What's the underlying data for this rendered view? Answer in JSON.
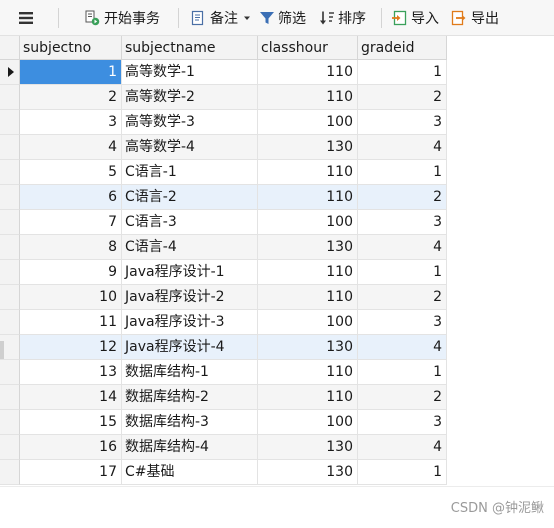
{
  "toolbar": {
    "menu_icon": "hamburger-icon",
    "begin_transaction": "开始事务",
    "notes": "备注",
    "filter": "筛选",
    "sort": "排序",
    "import": "导入",
    "export": "导出"
  },
  "table": {
    "columns": [
      "subjectno",
      "subjectname",
      "classhour",
      "gradeid"
    ],
    "rows": [
      {
        "subjectno": "1",
        "subjectname": "高等数学-1",
        "classhour": "110",
        "gradeid": "1"
      },
      {
        "subjectno": "2",
        "subjectname": "高等数学-2",
        "classhour": "110",
        "gradeid": "2"
      },
      {
        "subjectno": "3",
        "subjectname": "高等数学-3",
        "classhour": "100",
        "gradeid": "3"
      },
      {
        "subjectno": "4",
        "subjectname": "高等数学-4",
        "classhour": "130",
        "gradeid": "4"
      },
      {
        "subjectno": "5",
        "subjectname": "C语言-1",
        "classhour": "110",
        "gradeid": "1"
      },
      {
        "subjectno": "6",
        "subjectname": "C语言-2",
        "classhour": "110",
        "gradeid": "2"
      },
      {
        "subjectno": "7",
        "subjectname": "C语言-3",
        "classhour": "100",
        "gradeid": "3"
      },
      {
        "subjectno": "8",
        "subjectname": "C语言-4",
        "classhour": "130",
        "gradeid": "4"
      },
      {
        "subjectno": "9",
        "subjectname": "Java程序设计-1",
        "classhour": "110",
        "gradeid": "1"
      },
      {
        "subjectno": "10",
        "subjectname": "Java程序设计-2",
        "classhour": "110",
        "gradeid": "2"
      },
      {
        "subjectno": "11",
        "subjectname": "Java程序设计-3",
        "classhour": "100",
        "gradeid": "3"
      },
      {
        "subjectno": "12",
        "subjectname": "Java程序设计-4",
        "classhour": "130",
        "gradeid": "4"
      },
      {
        "subjectno": "13",
        "subjectname": "数据库结构-1",
        "classhour": "110",
        "gradeid": "1"
      },
      {
        "subjectno": "14",
        "subjectname": "数据库结构-2",
        "classhour": "110",
        "gradeid": "2"
      },
      {
        "subjectno": "15",
        "subjectname": "数据库结构-3",
        "classhour": "100",
        "gradeid": "3"
      },
      {
        "subjectno": "16",
        "subjectname": "数据库结构-4",
        "classhour": "130",
        "gradeid": "4"
      },
      {
        "subjectno": "17",
        "subjectname": "C#基础",
        "classhour": "130",
        "gradeid": "1"
      }
    ],
    "selected_row_index": 0,
    "highlighted_rows": [
      5,
      11
    ]
  },
  "watermark": "CSDN @钟泥鳅",
  "colors": {
    "active_cell": "#3d8ee0",
    "selected_row": "#e8f1fb",
    "alt_row": "#f5f5f5",
    "header": "#f3f3f3"
  }
}
